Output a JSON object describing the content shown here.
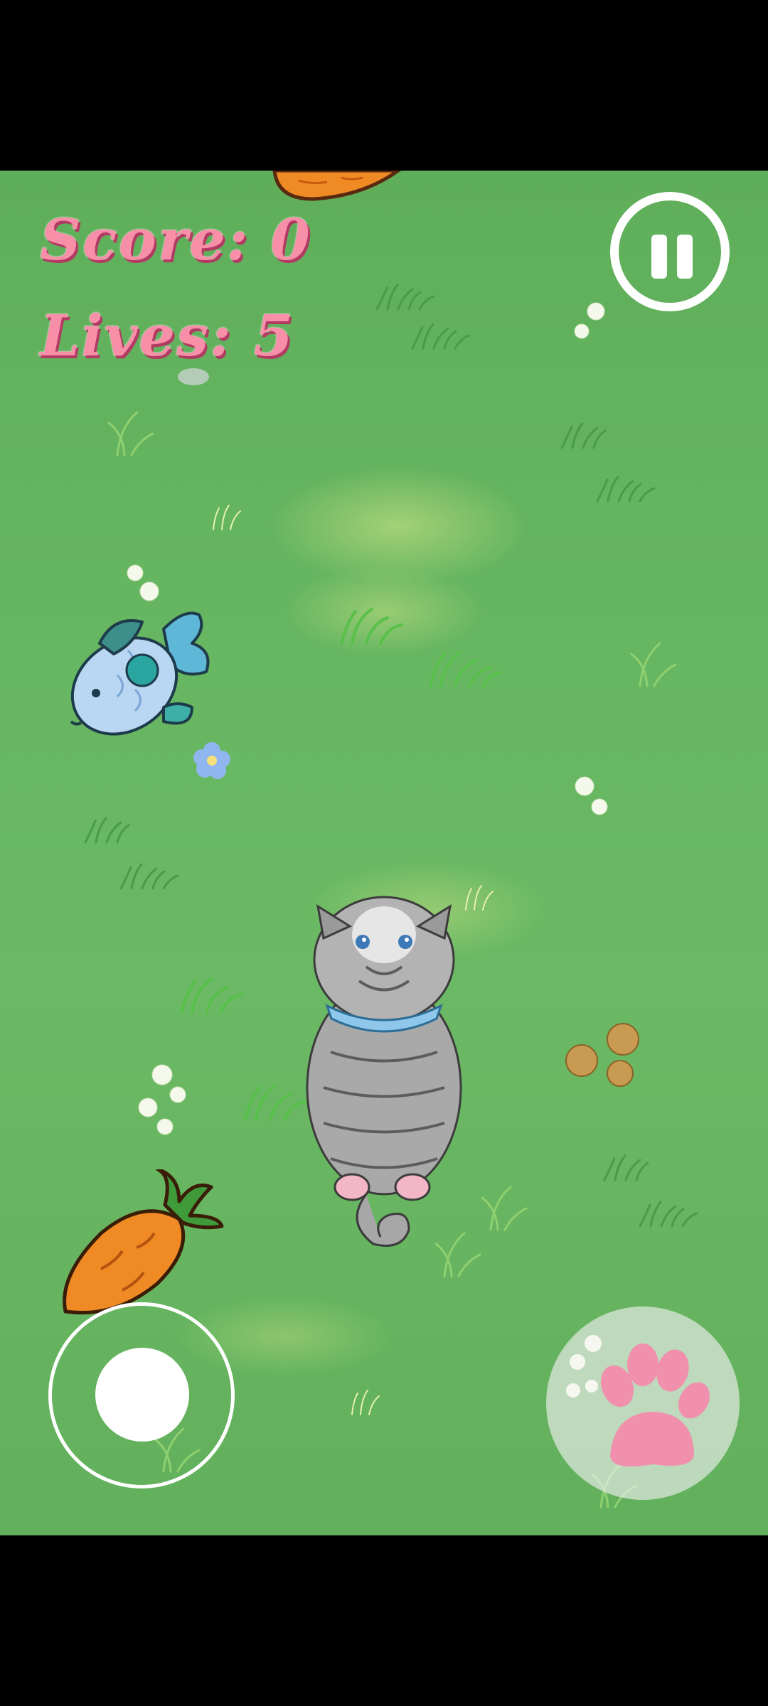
{
  "hud": {
    "score_text": "Score: 0",
    "lives_text": "Lives: 5"
  },
  "controls": {
    "pause_icon": "pause-icon",
    "joystick": "joystick",
    "action_icon": "paw-icon"
  },
  "sprites": [
    "carrot",
    "fish",
    "cat",
    "carrot",
    "flowers",
    "grass-tufts"
  ],
  "colors": {
    "grass": "#66b561",
    "hud_text": "#f78fa8",
    "hud_shadow": "#b23a63",
    "paw": "#f090ad",
    "carrot": "#f08a24"
  }
}
